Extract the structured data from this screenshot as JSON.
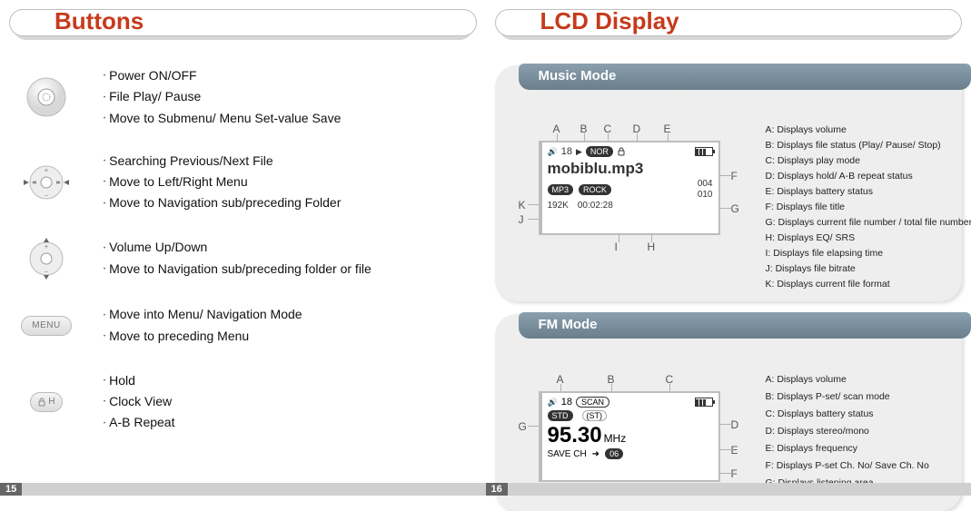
{
  "left": {
    "title": "Buttons",
    "page": "15",
    "groups": [
      {
        "items": [
          "Power ON/OFF",
          "File Play/ Pause",
          "Move to Submenu/ Menu Set-value Save"
        ]
      },
      {
        "items": [
          "Searching Previous/Next File",
          "Move to Left/Right Menu",
          "Move to Navigation sub/preceding Folder"
        ]
      },
      {
        "items": [
          "Volume Up/Down",
          "Move to Navigation sub/preceding folder or file"
        ]
      },
      {
        "items": [
          "Move into Menu/ Navigation Mode",
          "Move to preceding Menu"
        ]
      },
      {
        "items": [
          "Hold",
          "Clock View",
          "A-B Repeat"
        ]
      }
    ],
    "menu_label": "MENU",
    "hold_label": "H"
  },
  "right": {
    "title": "LCD Display",
    "page": "16",
    "music": {
      "tab": "Music Mode",
      "markers_top": [
        "A",
        "B",
        "C",
        "D",
        "E"
      ],
      "markers_side_right": [
        "F",
        "G"
      ],
      "markers_bottom": [
        "I",
        "H"
      ],
      "markers_side_left": [
        "K",
        "J"
      ],
      "lcd": {
        "volume": "18",
        "play_triangle": "▶",
        "mode_badge": "NOR",
        "title": "mobiblu.mp3",
        "fmt_badge": "MP3",
        "eq_badge": "ROCK",
        "bitrate": "192K",
        "elapsed": "00:02:28",
        "cur": "004",
        "total": "010"
      },
      "legend": {
        "A": "A: Displays volume",
        "B": "B: Displays file status (Play/ Pause/ Stop)",
        "C": "C: Displays play mode",
        "D": "D: Displays hold/ A-B repeat status",
        "E": "E: Displays battery status",
        "F": "F: Displays file title",
        "G": "G: Displays current file number / total file numbers",
        "H": "H: Displays EQ/ SRS",
        "I": "I: Displays file elapsing time",
        "J": "J: Displays file bitrate",
        "K": "K: Displays current file format"
      }
    },
    "fm": {
      "tab": "FM Mode",
      "markers_top": [
        "A",
        "B",
        "C"
      ],
      "markers_side_right": [
        "D",
        "E",
        "F"
      ],
      "markers_side_left": [
        "G"
      ],
      "lcd": {
        "volume": "18",
        "scan_badge": "SCAN",
        "area_badge": "STD",
        "st_badge": "ST",
        "freq": "95.30",
        "unit": "MHz",
        "save_label": "SAVE CH",
        "arrow": "➜",
        "ch": "06"
      },
      "legend": {
        "A": "A: Displays volume",
        "B": "B: Displays P-set/ scan mode",
        "C": "C: Displays battery status",
        "D": "D: Displays stereo/mono",
        "E": "E: Displays frequency",
        "F": "F: Displays P-set Ch. No/ Save Ch. No",
        "G": "G: Displays listening area"
      }
    }
  }
}
